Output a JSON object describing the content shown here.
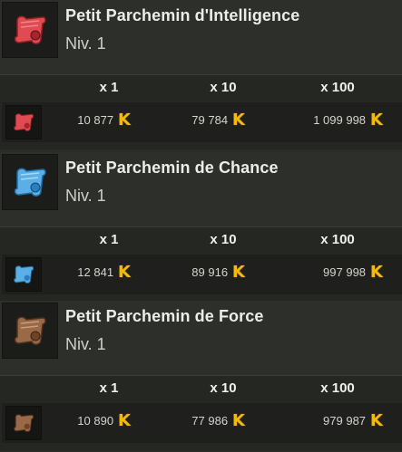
{
  "currency_symbol": "K",
  "headers": [
    "x 1",
    "x 10",
    "x 100"
  ],
  "items": [
    {
      "name": "Petit Parchemin d'Intelligence",
      "level": "Niv. 1",
      "color": "#e04a52",
      "prices": [
        "10 877",
        "79 784",
        "1 099 998"
      ]
    },
    {
      "name": "Petit Parchemin de Chance",
      "level": "Niv. 1",
      "color": "#5ab0e6",
      "prices": [
        "12 841",
        "89 916",
        "997 998"
      ]
    },
    {
      "name": "Petit Parchemin de Force",
      "level": "Niv. 1",
      "color": "#9a6a48",
      "prices": [
        "10 890",
        "77 986",
        "979 987"
      ]
    }
  ]
}
